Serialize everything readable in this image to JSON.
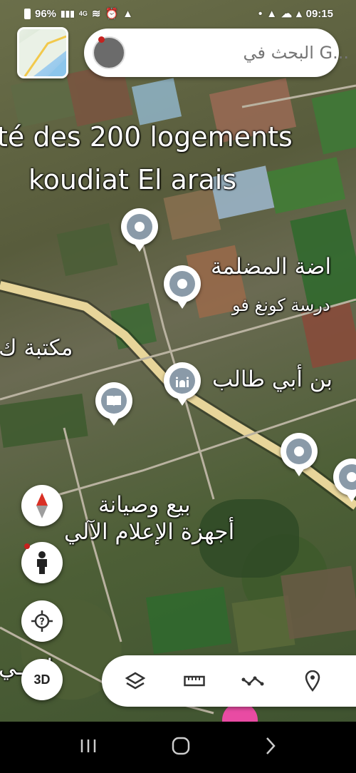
{
  "status_bar": {
    "battery": "96%",
    "network": "4G",
    "time": "09:15"
  },
  "search": {
    "placeholder": "البحث في G..."
  },
  "map_labels": {
    "residence_line1": "té des 200 logements",
    "residence_line2": "koudiat El arais",
    "place1": "اضة المضلمة",
    "place2": "درسة كونغ فو",
    "place3": "مكتبة ك",
    "place4": "بن أبي طالب",
    "place5": "بيع وصيانة",
    "place6": "أجهزة الإعلام الآلي",
    "place7": "لاد ـي"
  },
  "controls": {
    "three_d_label": "3D"
  },
  "icons": {
    "compass": "compass-icon",
    "pegman": "pegman-icon",
    "my_location": "my-location-icon",
    "layers": "layers-icon",
    "measure": "ruler-icon",
    "path": "path-icon",
    "placemark": "placemark-icon"
  },
  "colors": {
    "accent_red": "#c5221f",
    "pin_grey": "#8a9aa8",
    "road": "#e7d59a",
    "pink_fab": "#e94ba3"
  }
}
